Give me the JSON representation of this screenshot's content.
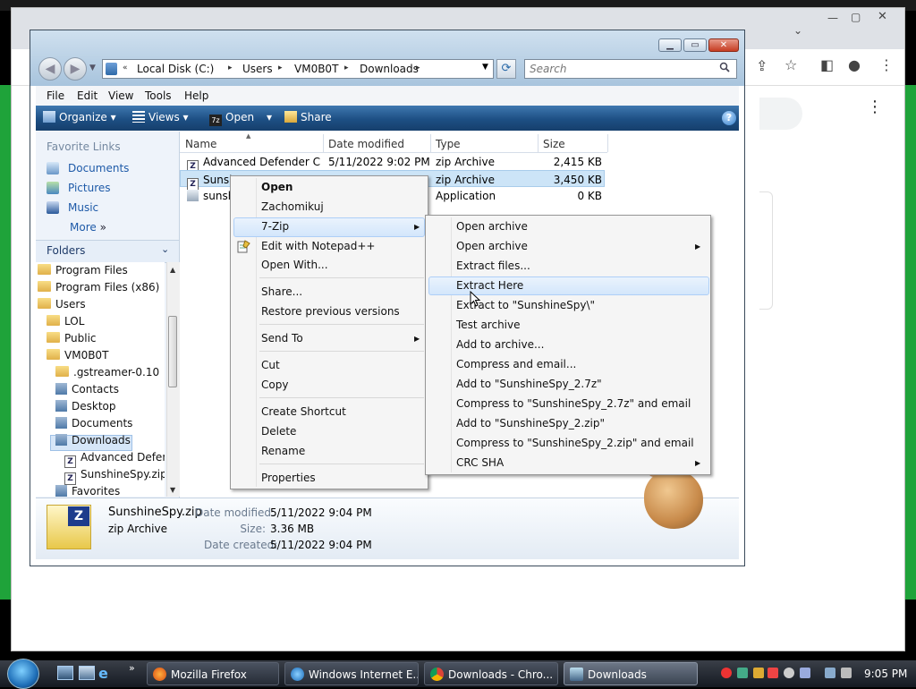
{
  "background_browser": {
    "search_placeholder": ""
  },
  "explorer": {
    "breadcrumb": [
      "Local Disk (C:)",
      "Users",
      "VM0B0T",
      "Downloads"
    ],
    "search_placeholder": "Search",
    "menu": [
      "File",
      "Edit",
      "View",
      "Tools",
      "Help"
    ],
    "toolbar": {
      "organize": "Organize",
      "views": "Views",
      "open": "Open",
      "share": "Share"
    },
    "favorites_title": "Favorite Links",
    "favorites": [
      "Documents",
      "Pictures",
      "Music",
      "More"
    ],
    "folders_label": "Folders",
    "tree": [
      "Program Files",
      "Program Files (x86)",
      "Users",
      "LOL",
      "Public",
      "VM0B0T",
      ".gstreamer-0.10",
      "Contacts",
      "Desktop",
      "Documents",
      "Downloads",
      "Advanced Defen",
      "SunshineSpy.zip",
      "Favorites"
    ],
    "columns": [
      "Name",
      "Date modified",
      "Type",
      "Size"
    ],
    "files": [
      {
        "name": "Advanced Defender Cr...",
        "date": "5/11/2022 9:02 PM",
        "type": "zip Archive",
        "size": "2,415 KB"
      },
      {
        "name": "Sunsh",
        "date": "",
        "type": "zip Archive",
        "size": "3,450 KB"
      },
      {
        "name": "sunsh",
        "date": "",
        "type": "Application",
        "size": "0 KB"
      }
    ],
    "details": {
      "filename": "SunshineSpy.zip",
      "filetype": "zip Archive",
      "modified_label": "Date modified:",
      "modified": "5/11/2022 9:04 PM",
      "size_label": "Size:",
      "size": "3.36 MB",
      "created_label": "Date created:",
      "created": "5/11/2022 9:04 PM"
    }
  },
  "context_menu": {
    "items": [
      "Open",
      "Zachomikuj",
      "7-Zip",
      "Edit with Notepad++",
      "Open With...",
      "Share...",
      "Restore previous versions",
      "Send To",
      "Cut",
      "Copy",
      "Create Shortcut",
      "Delete",
      "Rename",
      "Properties"
    ]
  },
  "zip_submenu": {
    "items": [
      "Open archive",
      "Open archive",
      "Extract files...",
      "Extract Here",
      "Extract to \"SunshineSpy\\\"",
      "Test archive",
      "Add to archive...",
      "Compress and email...",
      "Add to \"SunshineSpy_2.7z\"",
      "Compress to \"SunshineSpy_2.7z\" and email",
      "Add to \"SunshineSpy_2.zip\"",
      "Compress to \"SunshineSpy_2.zip\" and email",
      "CRC SHA"
    ]
  },
  "taskbar": {
    "buttons": [
      "Mozilla Firefox",
      "Windows Internet E...",
      "Downloads - Chro...",
      "Downloads"
    ],
    "clock": "9:05 PM"
  }
}
